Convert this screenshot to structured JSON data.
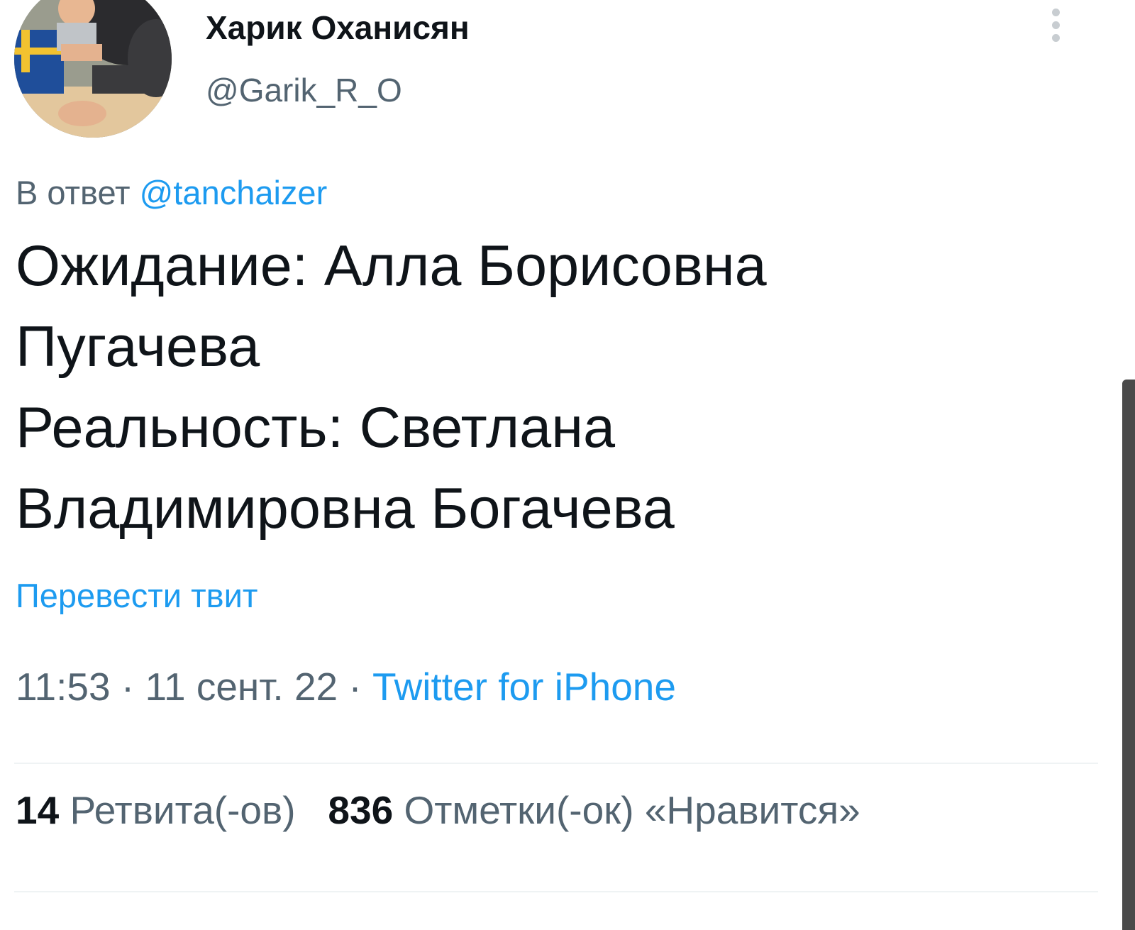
{
  "author": {
    "display_name": "Харик Оханисян",
    "handle": "@Garik_R_O",
    "avatar_icon": "avatar-photo"
  },
  "reply": {
    "prefix": "В ответ",
    "mention": "@tanchaizer"
  },
  "tweet": {
    "lines": [
      "Ожидание: Алла Борисовна",
      "Пугачева",
      "Реальность: Светлана",
      "Владимировна Богачева"
    ],
    "translate_label": "Перевести твит"
  },
  "meta": {
    "time": "11:53",
    "separator_1": " · ",
    "date": "11 сент. 22",
    "separator_2": " · ",
    "source": "Twitter for iPhone"
  },
  "stats": {
    "retweets_count": "14",
    "retweets_label": "Ретвита(-ов)",
    "likes_count": "836",
    "likes_label": "Отметки(-ок) «Нравится»"
  },
  "colors": {
    "accent": "#1d9bf0",
    "text_primary": "#0f1419",
    "text_secondary": "#536471",
    "divider": "#eff3f4"
  }
}
